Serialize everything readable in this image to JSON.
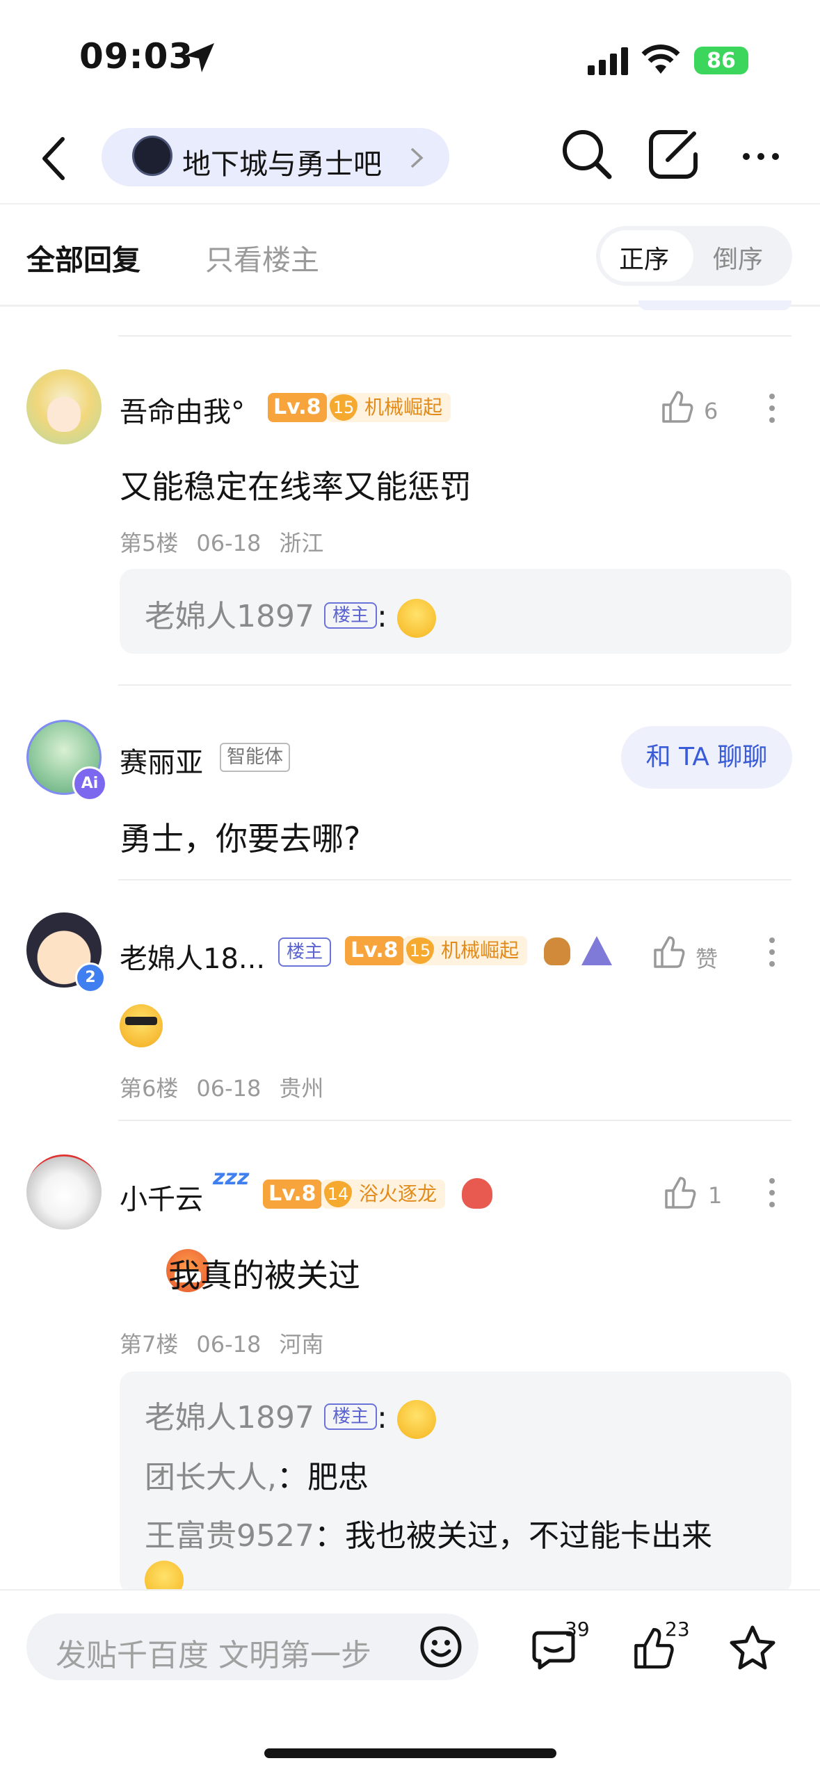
{
  "status_bar": {
    "time": "09:03",
    "battery": "86"
  },
  "nav": {
    "forum_name": "地下城与勇士吧"
  },
  "tabs": {
    "all": "全部回复",
    "op_only": "只看楼主",
    "order_asc": "正序",
    "order_desc": "倒序"
  },
  "posts": [
    {
      "username": "吾命由我°",
      "level": "Lv.8",
      "badge_num": "15",
      "badge_label": "机械崛起",
      "like_count": "6",
      "content": "又能稳定在线率又能惩罚",
      "floor": "第5楼",
      "date": "06-18",
      "location": "浙江",
      "replies": [
        {
          "name": "老婂人1897",
          "tag": "楼主",
          "sep": ":"
        }
      ]
    },
    {
      "username": "赛丽亚",
      "tag": "智能体",
      "chat_label": "和 TA 聊聊",
      "content": "勇士，你要去哪?"
    },
    {
      "username": "老婂人18...",
      "tag": "楼主",
      "level": "Lv.8",
      "badge_num": "15",
      "badge_label": "机械崛起",
      "like_label": "赞",
      "floor": "第6楼",
      "date": "06-18",
      "location": "贵州",
      "avatar_badge": "2"
    },
    {
      "username": "小千云",
      "level": "Lv.8",
      "badge_num": "14",
      "badge_label": "浴火逐龙",
      "like_count": "1",
      "content": "我真的被关过",
      "floor": "第7楼",
      "date": "06-18",
      "location": "河南",
      "replies": [
        {
          "name": "老婂人1897",
          "tag": "楼主",
          "sep": ":"
        },
        {
          "name": "团长大人,",
          "text": "：肥忠"
        },
        {
          "name": "王富贵9527",
          "text": "：我也被关过，不过能卡出来"
        }
      ]
    }
  ],
  "bottom_bar": {
    "compose_placeholder": "发贴千百度 文明第一步",
    "comment_count": "39",
    "like_count": "23"
  },
  "colors": {
    "accent": "#3a5bd8",
    "level": "#f7a43d",
    "battery": "#3bd65b"
  }
}
